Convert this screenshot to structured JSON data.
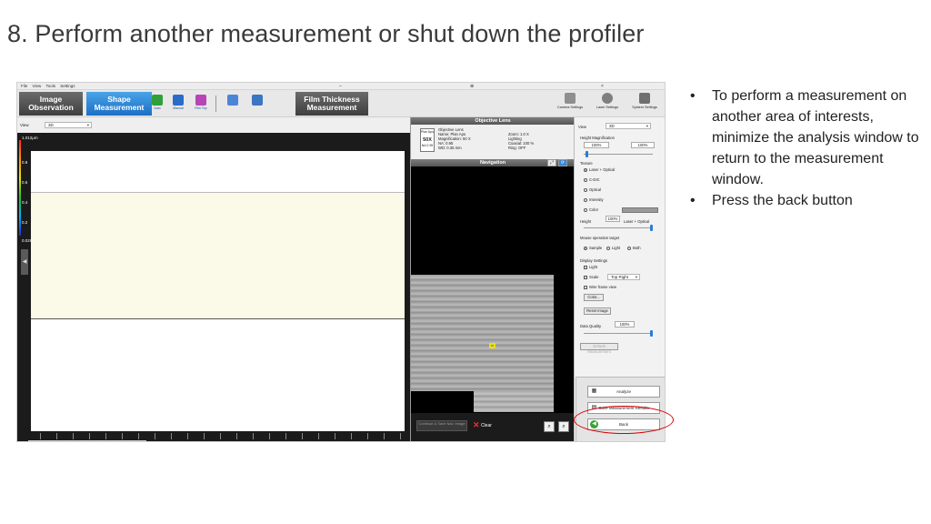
{
  "slide": {
    "title": "8. Perform another measurement or shut down the profiler",
    "bullets": [
      "To perform a measurement on another area of interests, minimize the analysis window to return to the measurement window.",
      "Press the back button"
    ]
  },
  "app": {
    "menu": [
      "File",
      "View",
      "Tools",
      "Settings"
    ],
    "ribbon": {
      "tabs": [
        "Image Observation",
        "Shape Measurement",
        "Film Thickness Measurement"
      ],
      "active_tab": "Shape Measurement",
      "mode_icons": [
        "Auto",
        "Manual",
        "Film Top"
      ],
      "tools": [
        "Camera Settings",
        "Laser Settings",
        "System Settings"
      ],
      "accent": "#1b6fc4"
    },
    "left_view": {
      "view_label": "View",
      "view_value": "3D",
      "scale_top": "1.012μm",
      "scale_labels": [
        "0.8",
        "0.6",
        "0.4",
        "0.2",
        "0.029"
      ]
    },
    "objective": {
      "header": "Objective Lens",
      "lens_name_small": "Plan Apo",
      "lens_mag": "50X",
      "lens_na": "NA 0.95",
      "title": "Objective Lens",
      "name": "Name:  Plan Apo",
      "magnification": "Magnification:   50 X",
      "na": "NA:          0.95",
      "wd": "WD:         0.35 mm",
      "zoom": "Zoom:        1.0 X",
      "lighting": "Lighting",
      "coaxial": "Coaxial:      100 %",
      "ring": "Ring:          OFF"
    },
    "navigation": {
      "header": "Navigation",
      "save_btn": "Continue & Save Nav. Image",
      "clear_btn": "Clear"
    },
    "settings": {
      "view_label": "View",
      "view_value": "3D",
      "height_mag_label": "Height Magnification",
      "height_mag_left": "100%",
      "height_mag_right": "100%",
      "texture_label": "Texture",
      "texture_options": [
        "Laser + Optical",
        "C-DIC",
        "Optical",
        "Intensity",
        "Color"
      ],
      "texture_selected": "Laser + Optical",
      "height_label": "Height",
      "height_value": "100%",
      "height_mode": "Laser + Optical",
      "mouse_label": "Mouse operation target",
      "mouse_options": [
        "Sample",
        "Light",
        "Both"
      ],
      "mouse_selected": "Sample",
      "display_label": "Display Settings",
      "display_light": "Light",
      "display_scale": "Scale",
      "scale_pos": "Top Right",
      "wireframe": "Wire frame view",
      "color_btn": "Color...",
      "reset_btn": "Reset Image",
      "quality_label": "Data Quality",
      "quality_value": "100%",
      "disabled_btn": "Default Measurement",
      "analyze_btn": "Analyze",
      "save_btn": "Save Measurement Results",
      "back_btn": "Back"
    }
  }
}
